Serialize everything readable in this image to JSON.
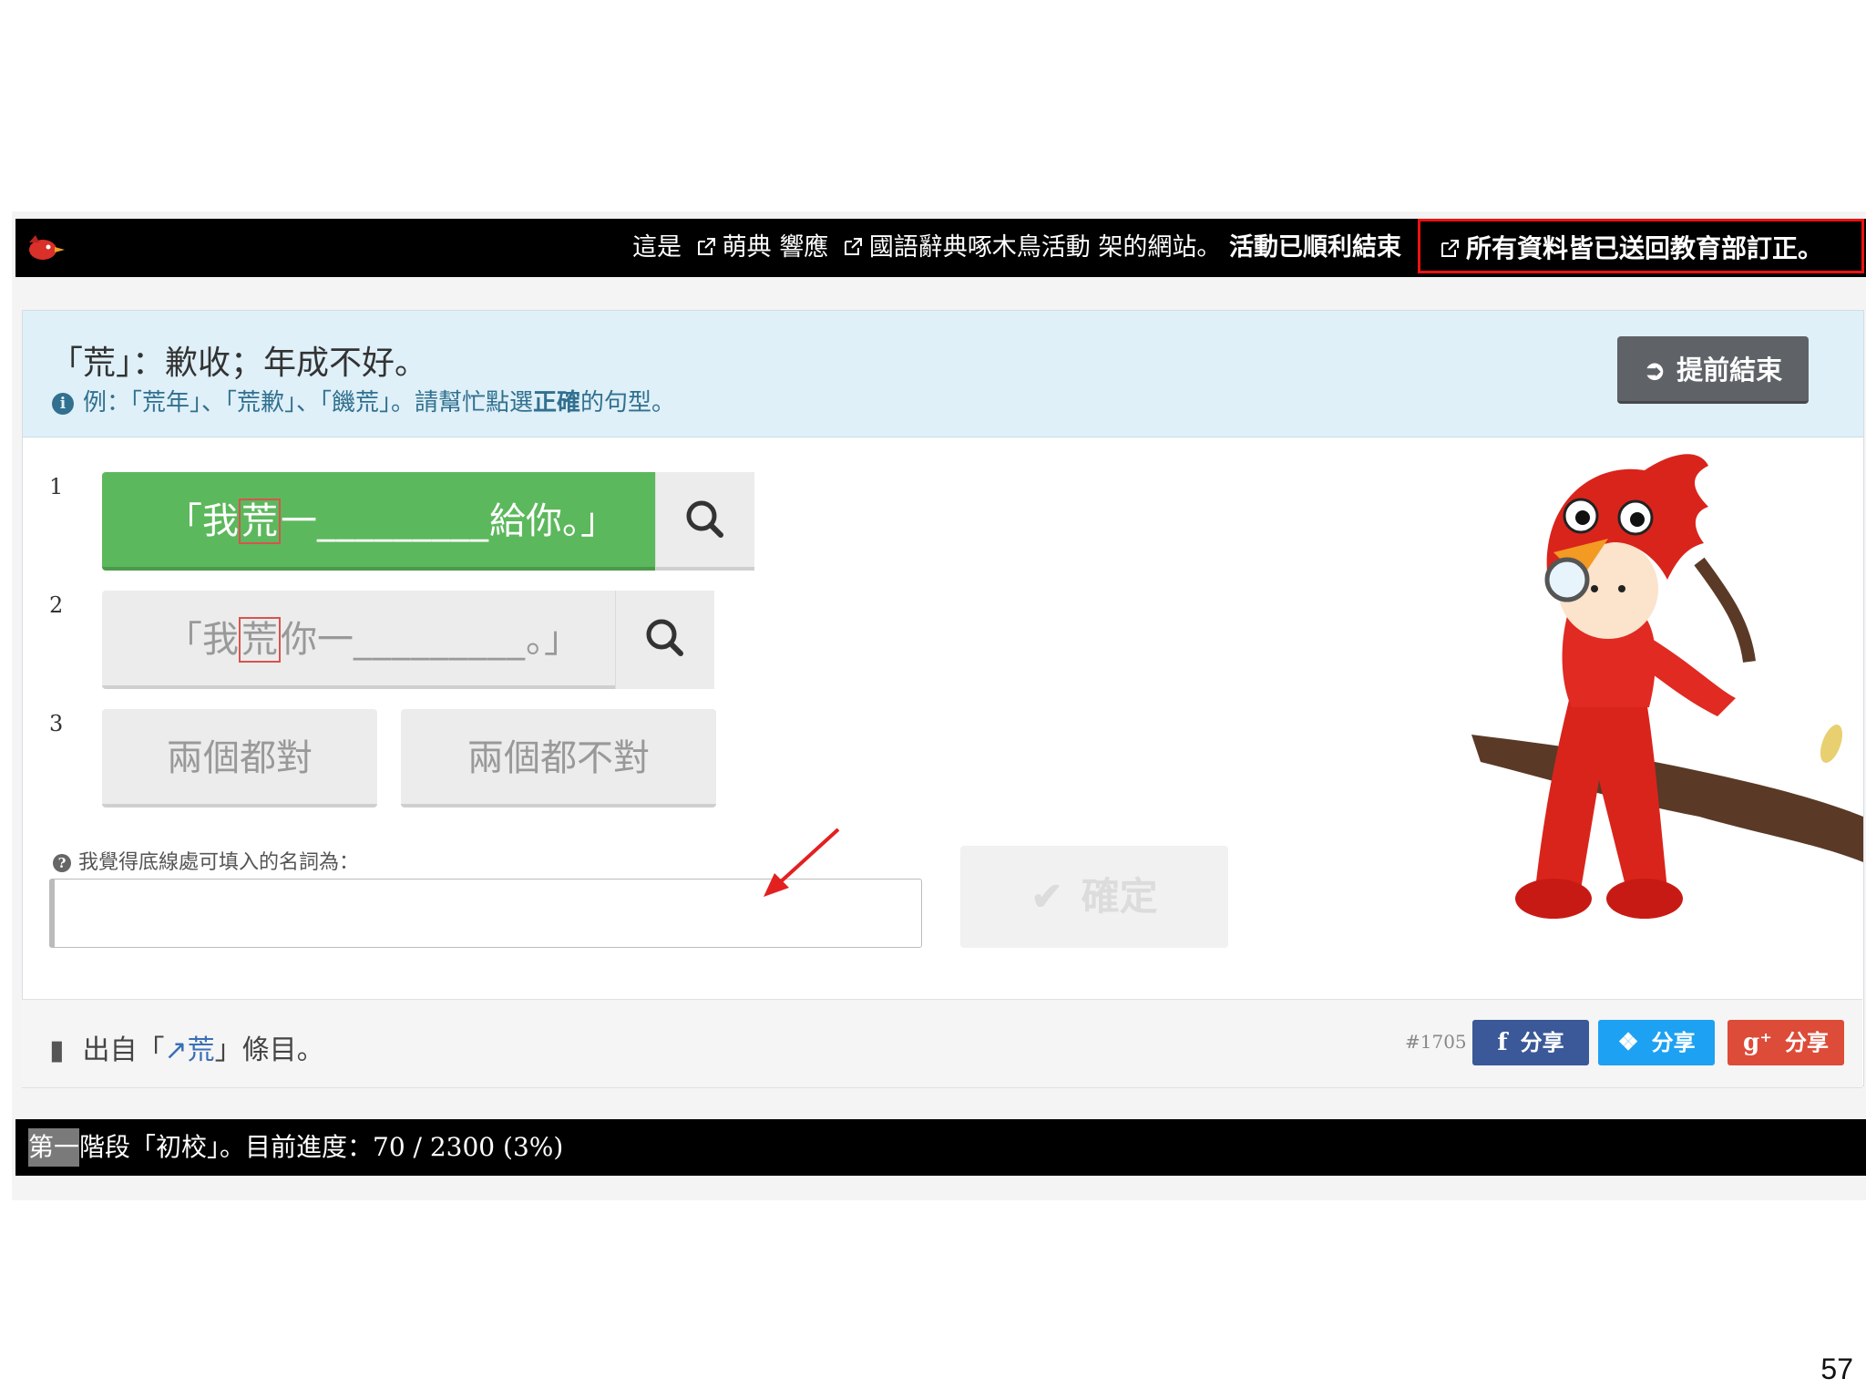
{
  "topbar": {
    "prefix": "這是",
    "link1": "萌典 響應",
    "link2": "國語辭典啄木鳥活動 架的網站。",
    "status": "活動已順利結束",
    "notice": "所有資料皆已送回教育部訂正。"
  },
  "header": {
    "definition": "「荒」：歉收；年成不好。",
    "example_prefix": "例：「荒年」、「荒歉」、「饑荒」。請幫忙點選",
    "example_strong": "正確",
    "example_suffix": "的句型。",
    "end_button": "提前結束"
  },
  "options": [
    {
      "num": "1",
      "before": "「我",
      "char": "荒",
      "after": "一",
      "blank": "_________",
      "tail": "給你。」"
    },
    {
      "num": "2",
      "before": "「我",
      "char": "荒",
      "after": "你一",
      "blank": "_________",
      "tail": "。」"
    },
    {
      "num": "3",
      "a": "兩個都對",
      "b": "兩個都不對"
    }
  ],
  "question": {
    "label": "我覺得底線處可填入的名詞為：",
    "answer_value": "",
    "confirm": "確定"
  },
  "footer": {
    "src_prefix": "出自「",
    "src_link": "荒",
    "src_suffix": "」條目。",
    "entry_id": "#1705",
    "share_fb": "分享",
    "share_tw": "分享",
    "share_gp": "分享"
  },
  "statusbar": {
    "text": "第一階段「初校」。目前進度：70 / 2300 (3%)",
    "progress": {
      "done": 70,
      "total": 2300,
      "percent": 3
    }
  },
  "page_number": "57",
  "colors": {
    "accent_green": "#5cb85c",
    "info_blue": "#31708f",
    "fb": "#3b5998",
    "tw": "#1da1f2",
    "gp": "#dd4b39",
    "notice_border": "#e11111"
  }
}
